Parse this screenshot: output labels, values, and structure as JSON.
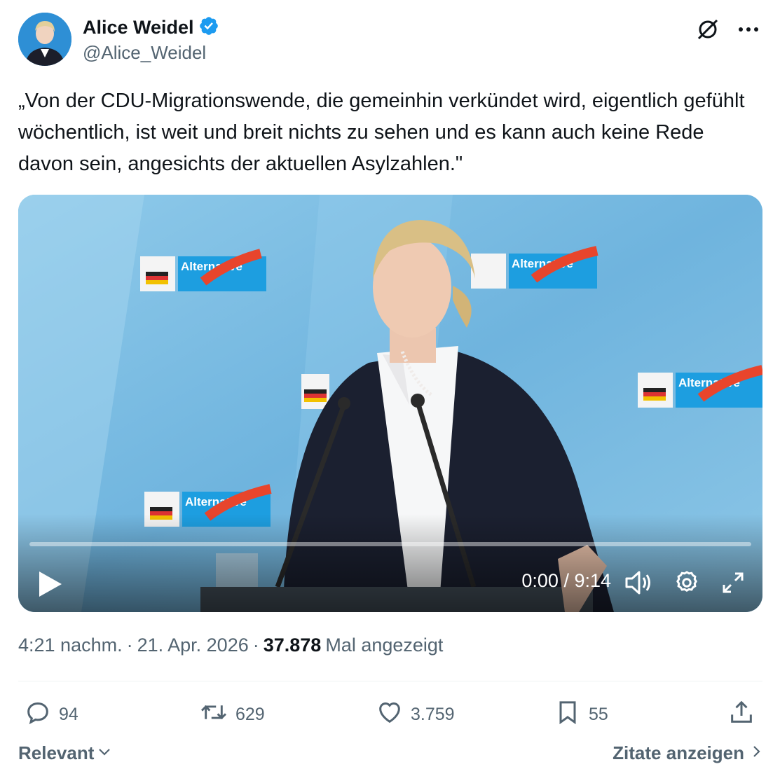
{
  "author": {
    "display_name": "Alice Weidel",
    "handle": "@Alice_Weidel",
    "verified": true
  },
  "tweet": {
    "text": "„Von der CDU-Migrationswende, die gemeinhin verkündet wird, eigentlich gefühlt wöchentlich, ist weit und breit nichts zu sehen und es kann auch keine Rede davon sein, angesichts der aktuellen Asylzahlen.\""
  },
  "video": {
    "time": "0:00 / 9:14",
    "progress": 0,
    "backdrop_logo_text": "Alternative"
  },
  "meta": {
    "time": "4:21 nachm.",
    "separator": "·",
    "date": "21. Apr. 2026",
    "views": "37.878",
    "views_label": "Mal angezeigt"
  },
  "actions": {
    "replies": "94",
    "reposts": "629",
    "likes": "3.759",
    "bookmarks": "55"
  },
  "footer": {
    "sort_label": "Relevant",
    "quotes_label": "Zitate anzeigen"
  },
  "colors": {
    "accent": "#1d9bf0",
    "secondary_text": "#536471",
    "primary_text": "#0f1419"
  }
}
